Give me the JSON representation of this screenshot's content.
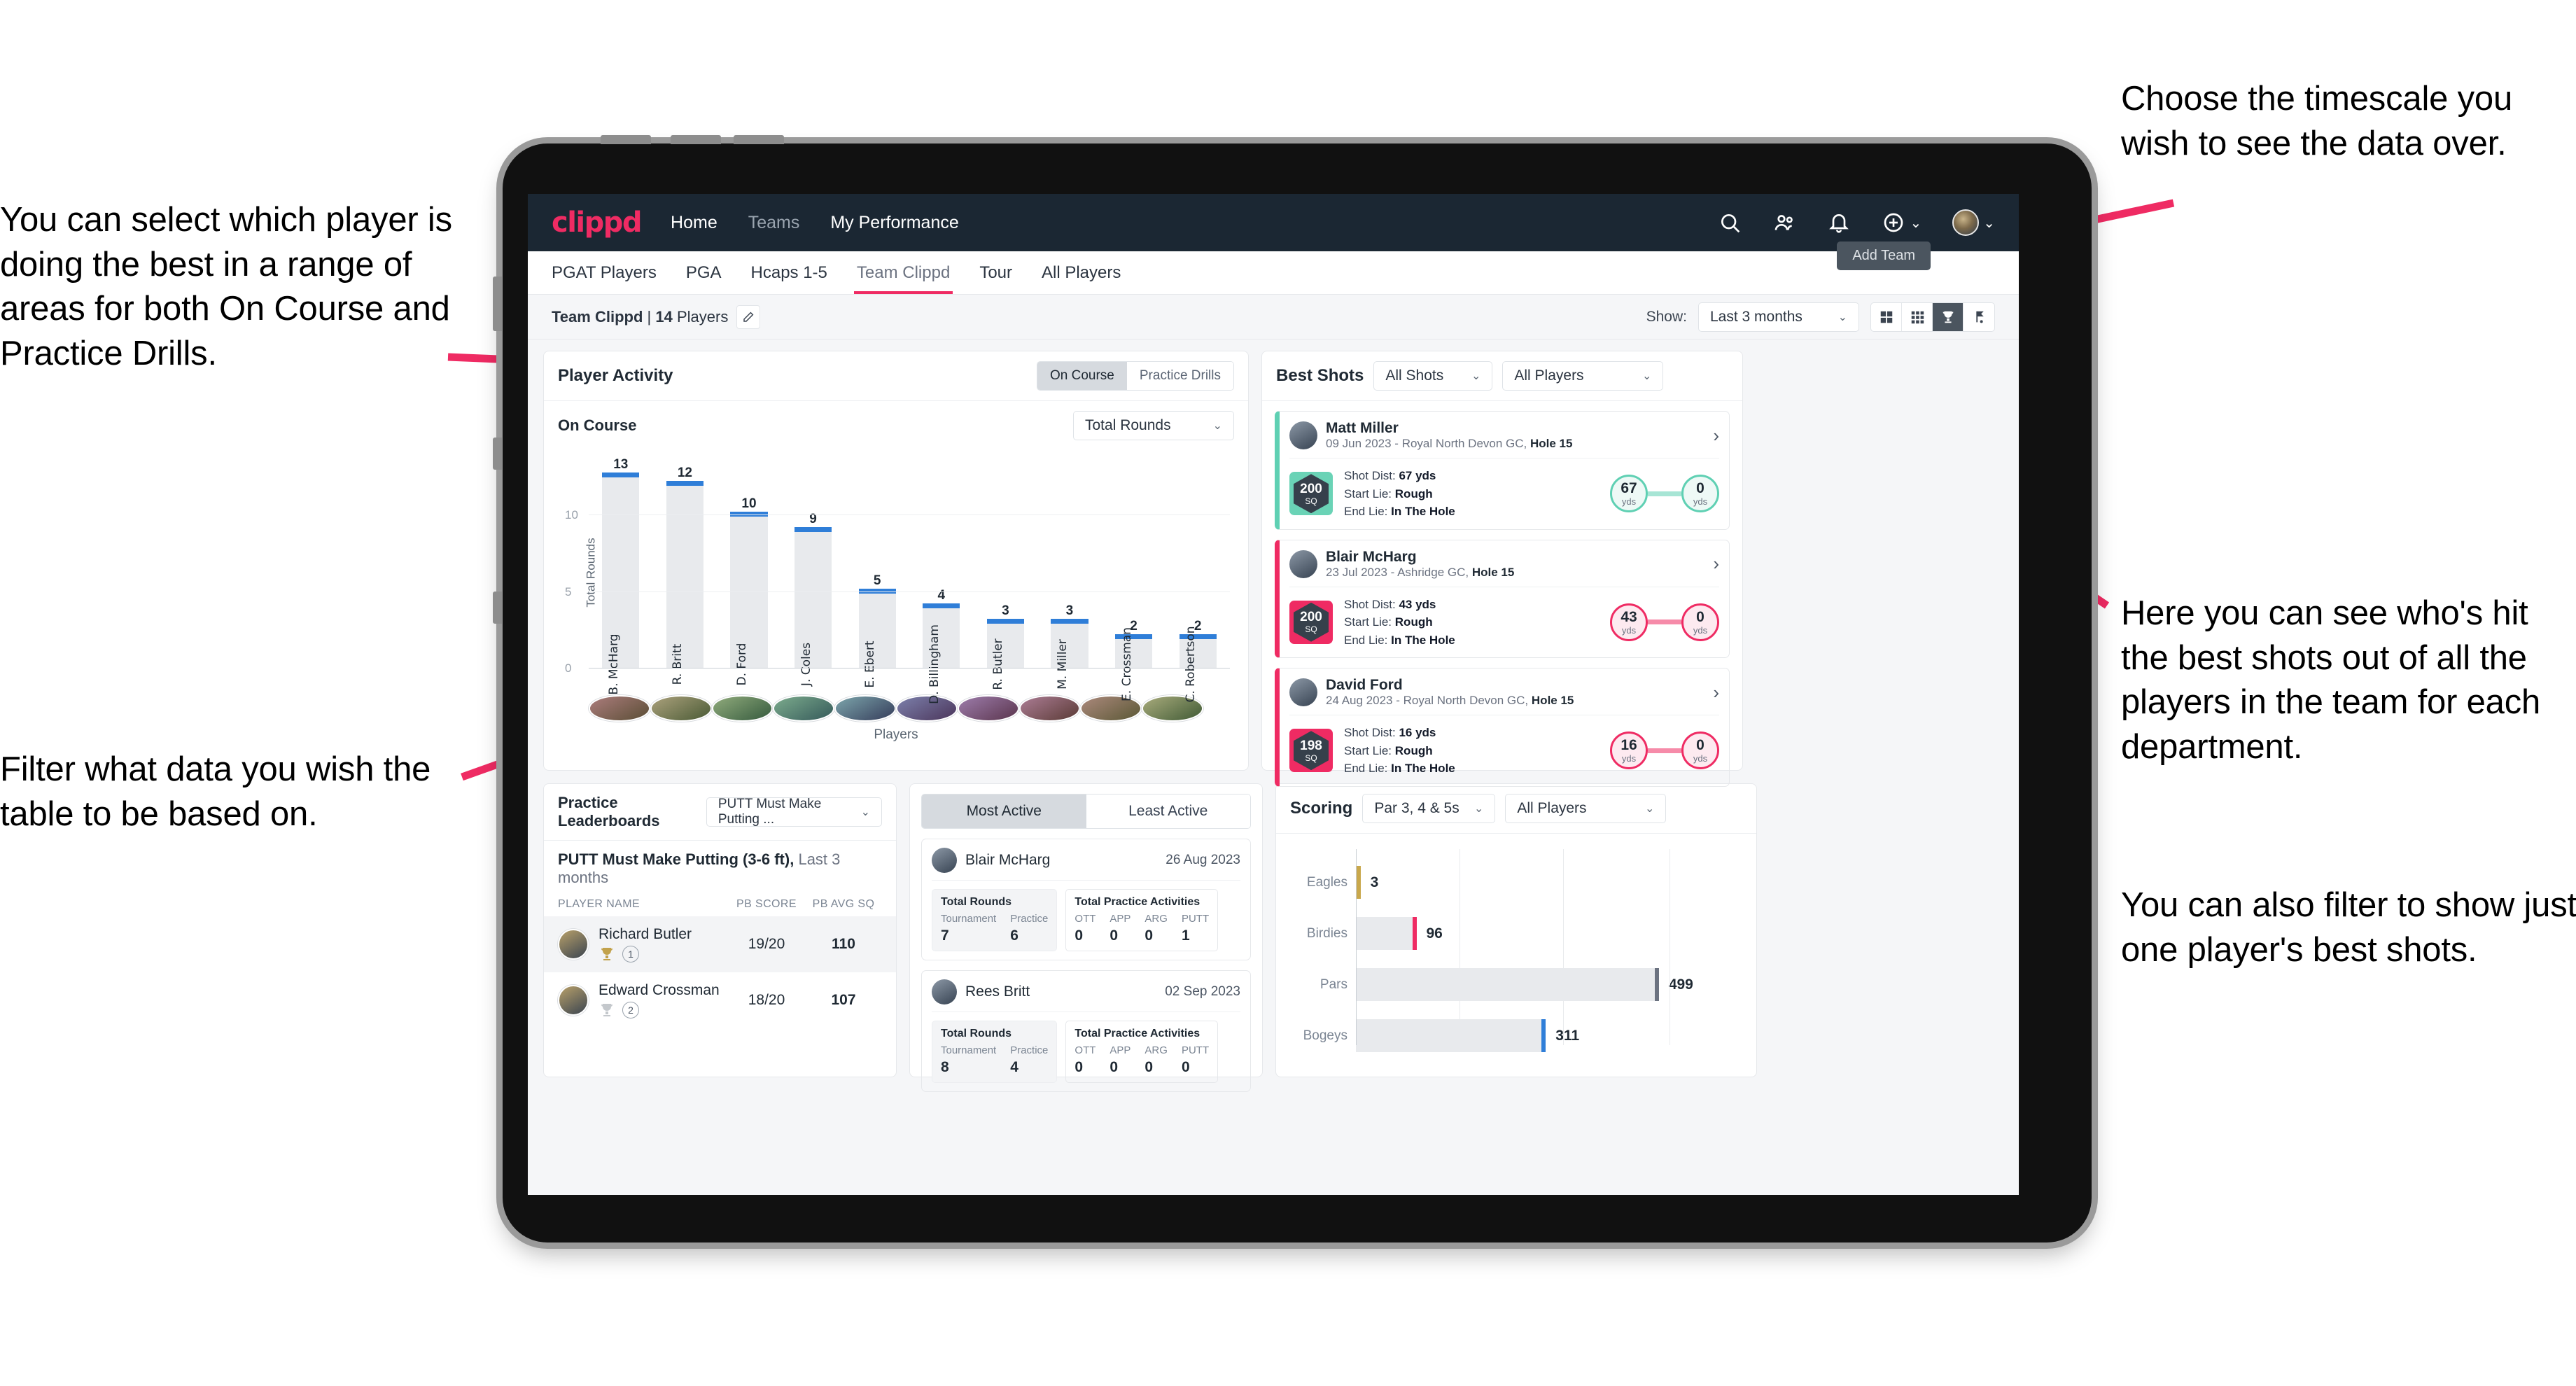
{
  "annotations": {
    "left_top": "You can select which player is doing the best in a range of areas for both On Course and Practice Drills.",
    "left_bottom": "Filter what data you wish the table to be based on.",
    "right_top": "Choose the timescale you wish to see the data over.",
    "right_middle": "Here you can see who's hit the best shots out of all the players in the team for each department.",
    "right_bottom": "You can also filter to show just one player's best shots."
  },
  "topbar": {
    "logo": "clippd",
    "links": [
      {
        "label": "Home",
        "dim": false
      },
      {
        "label": "Teams",
        "dim": true
      },
      {
        "label": "My Performance",
        "dim": false
      }
    ],
    "icons": [
      "search-icon",
      "people-icon",
      "bell-icon",
      "plus-circle-icon",
      "avatar"
    ]
  },
  "tabs": {
    "items": [
      {
        "label": "PGAT Players",
        "active": false
      },
      {
        "label": "PGA",
        "active": false
      },
      {
        "label": "Hcaps 1-5",
        "active": false
      },
      {
        "label": "Team Clippd",
        "active": true
      },
      {
        "label": "Tour",
        "active": false
      },
      {
        "label": "All Players",
        "active": false
      }
    ],
    "add_team_tooltip": "Add Team"
  },
  "subheader": {
    "team_name": "Team Clippd",
    "separator": "|",
    "player_count": "14",
    "players_word": "Players",
    "edit_icon": "pencil-icon",
    "show_label": "Show:",
    "timescale_value": "Last 3 months",
    "view_toggles": [
      {
        "name": "grid-large-icon",
        "active": false
      },
      {
        "name": "grid-small-icon",
        "active": false
      },
      {
        "name": "trophy-icon",
        "active": true
      },
      {
        "name": "golf-flag-icon",
        "active": false
      }
    ]
  },
  "player_activity": {
    "title": "Player Activity",
    "segment": [
      {
        "label": "On Course",
        "active": true
      },
      {
        "label": "Practice Drills",
        "active": false
      }
    ],
    "sub_label": "On Course",
    "metric_select": "Total Rounds",
    "x_axis_label": "Players"
  },
  "best_shots": {
    "title": "Best Shots",
    "filter_shots": "All Shots",
    "filter_players": "All Players",
    "shots": [
      {
        "player": "Matt Miller",
        "meta_date": "09 Jun 2023 - Royal North Devon GC,",
        "meta_hole": "Hole 15",
        "sq": "200",
        "sq_unit": "SQ",
        "accent": "teal",
        "shot_dist_label": "Shot Dist:",
        "shot_dist": "67 yds",
        "start_lie_label": "Start Lie:",
        "start_lie": "Rough",
        "end_lie_label": "End Lie:",
        "end_lie": "In The Hole",
        "from_value": "67",
        "from_unit": "yds",
        "to_value": "0",
        "to_unit": "yds"
      },
      {
        "player": "Blair McHarg",
        "meta_date": "23 Jul 2023 - Ashridge GC,",
        "meta_hole": "Hole 15",
        "sq": "200",
        "sq_unit": "SQ",
        "accent": "pink",
        "shot_dist_label": "Shot Dist:",
        "shot_dist": "43 yds",
        "start_lie_label": "Start Lie:",
        "start_lie": "Rough",
        "end_lie_label": "End Lie:",
        "end_lie": "In The Hole",
        "from_value": "43",
        "from_unit": "yds",
        "to_value": "0",
        "to_unit": "yds"
      },
      {
        "player": "David Ford",
        "meta_date": "24 Aug 2023 - Royal North Devon GC,",
        "meta_hole": "Hole 15",
        "sq": "198",
        "sq_unit": "SQ",
        "accent": "pink",
        "shot_dist_label": "Shot Dist:",
        "shot_dist": "16 yds",
        "start_lie_label": "Start Lie:",
        "start_lie": "Rough",
        "end_lie_label": "End Lie:",
        "end_lie": "In The Hole",
        "from_value": "16",
        "from_unit": "yds",
        "to_value": "0",
        "to_unit": "yds"
      }
    ]
  },
  "practice_leaderboards": {
    "title": "Practice Leaderboards",
    "drill_select": "PUTT Must Make Putting ...",
    "drill_name": "PUTT Must Make Putting (3-6 ft),",
    "period": "Last 3 months",
    "columns": [
      "PLAYER NAME",
      "PB SCORE",
      "PB AVG SQ"
    ],
    "rows": [
      {
        "name": "Richard Butler",
        "rank": "1",
        "pb_score": "19/20",
        "pb_avg_sq": "110",
        "trophy": "gold"
      },
      {
        "name": "Edward Crossman",
        "rank": "2",
        "pb_score": "18/20",
        "pb_avg_sq": "107",
        "trophy": "silver"
      }
    ]
  },
  "activity_panel": {
    "tabs": [
      {
        "label": "Most Active",
        "active": true
      },
      {
        "label": "Least Active",
        "active": false
      }
    ],
    "cards": [
      {
        "name": "Blair McHarg",
        "date": "26 Aug 2023",
        "rounds_title": "Total Rounds",
        "rounds_cols": [
          "Tournament",
          "Practice"
        ],
        "rounds_vals": [
          "7",
          "6"
        ],
        "practice_title": "Total Practice Activities",
        "practice_cols": [
          "OTT",
          "APP",
          "ARG",
          "PUTT"
        ],
        "practice_vals": [
          "0",
          "0",
          "0",
          "1"
        ]
      },
      {
        "name": "Rees Britt",
        "date": "02 Sep 2023",
        "rounds_title": "Total Rounds",
        "rounds_cols": [
          "Tournament",
          "Practice"
        ],
        "rounds_vals": [
          "8",
          "4"
        ],
        "practice_title": "Total Practice Activities",
        "practice_cols": [
          "OTT",
          "APP",
          "ARG",
          "PUTT"
        ],
        "practice_vals": [
          "0",
          "0",
          "0",
          "0"
        ]
      }
    ]
  },
  "scoring": {
    "title": "Scoring",
    "filter_par": "Par 3, 4 & 5s",
    "filter_players": "All Players"
  },
  "colors": {
    "brand_pink": "#ef2b63",
    "navy": "#1b2733",
    "bar_blue": "#2f7ed8",
    "bar_grey": "#e8eaed",
    "teal": "#5fd0b3",
    "gold": "#c9a84c"
  },
  "chart_data": [
    {
      "type": "bar",
      "title": "Player Activity - On Course",
      "xlabel": "Players",
      "ylabel": "Total Rounds",
      "ylim": [
        0,
        13.8
      ],
      "yticks": [
        0,
        5,
        10
      ],
      "grid": true,
      "categories": [
        "B. McHarg",
        "R. Britt",
        "D. Ford",
        "J. Coles",
        "E. Ebert",
        "D. Billingham",
        "R. Butler",
        "M. Miller",
        "E. Crossman",
        "C. Robertson"
      ],
      "values": [
        13,
        12,
        10,
        9,
        5,
        4,
        3,
        3,
        2,
        2
      ],
      "legend": []
    },
    {
      "type": "bar",
      "orientation": "horizontal",
      "title": "Scoring",
      "xlabel": "",
      "ylabel": "",
      "categories": [
        "Eagles",
        "Birdies",
        "Pars",
        "Bogeys"
      ],
      "values": [
        3,
        96,
        499,
        311
      ],
      "colors": [
        "#c9a84c",
        "#ef2b63",
        "#6b7280",
        "#2f7ed8"
      ],
      "xlim": [
        0,
        640
      ],
      "grid": true
    }
  ]
}
